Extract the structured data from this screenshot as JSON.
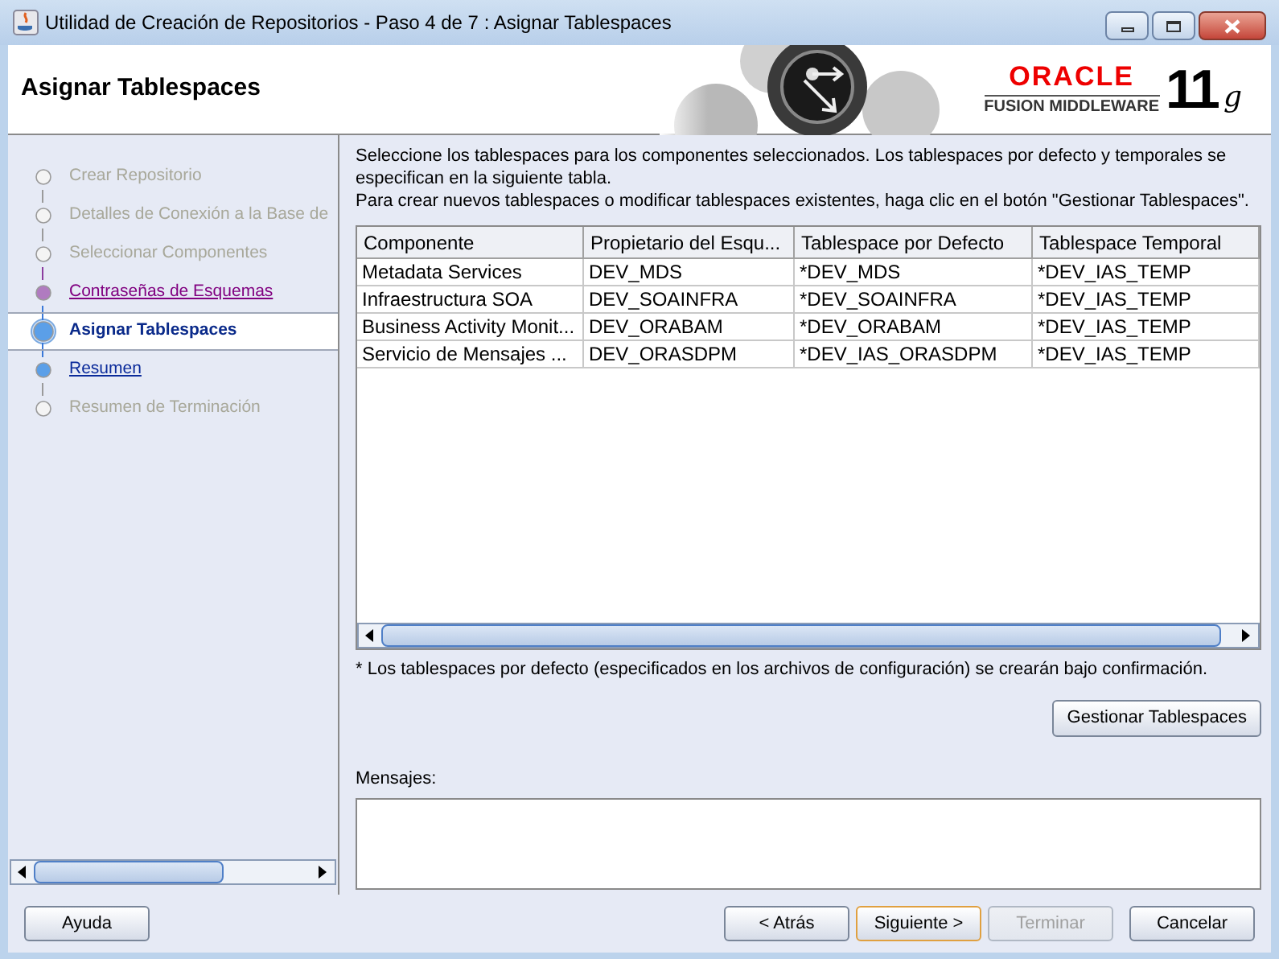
{
  "window": {
    "title": "Utilidad de Creación de Repositorios - Paso 4 de 7 : Asignar Tablespaces"
  },
  "header": {
    "title": "Asignar Tablespaces",
    "brand": "ORACLE",
    "product": "FUSION MIDDLEWARE",
    "version": "11",
    "version_suffix": "g"
  },
  "steps": [
    {
      "label": "Crear Repositorio",
      "kind": "done"
    },
    {
      "label": "Detalles de Conexión a la Base de",
      "kind": "done"
    },
    {
      "label": "Seleccionar Componentes",
      "kind": "done"
    },
    {
      "label": "Contraseñas de Esquemas",
      "kind": "visited"
    },
    {
      "label": "Asignar Tablespaces",
      "kind": "current"
    },
    {
      "label": "Resumen",
      "kind": "link"
    },
    {
      "label": "Resumen de Terminación",
      "kind": "pending"
    }
  ],
  "intro": [
    "Seleccione los tablespaces para los componentes seleccionados. Los tablespaces por defecto y temporales se especifican en la siguiente tabla.",
    "Para crear nuevos tablespaces o modificar tablespaces existentes, haga clic en el botón \"Gestionar Tablespaces\"."
  ],
  "table": {
    "columns": [
      "Componente",
      "Propietario del Esqu...",
      "Tablespace por Defecto",
      "Tablespace Temporal"
    ],
    "rows": [
      [
        "Metadata Services",
        "DEV_MDS",
        "*DEV_MDS",
        "*DEV_IAS_TEMP"
      ],
      [
        "Infraestructura SOA",
        "DEV_SOAINFRA",
        "*DEV_SOAINFRA",
        "*DEV_IAS_TEMP"
      ],
      [
        "Business Activity Monit...",
        "DEV_ORABAM",
        "*DEV_ORABAM",
        "*DEV_IAS_TEMP"
      ],
      [
        "Servicio de Mensajes ...",
        "DEV_ORASDPM",
        "*DEV_IAS_ORASDPM",
        "*DEV_IAS_TEMP"
      ]
    ]
  },
  "footnote": "* Los tablespaces por defecto (especificados en los archivos de configuración) se crearán bajo confirmación.",
  "manage_button": "Gestionar Tablespaces",
  "messages": {
    "label": "Mensajes:"
  },
  "buttons": [
    {
      "label": "Ayuda",
      "disabled": false,
      "default": false
    },
    {
      "label": "< Atrás",
      "disabled": false,
      "default": false
    },
    {
      "label": "Siguiente >",
      "disabled": false,
      "default": true
    },
    {
      "label": "Terminar",
      "disabled": true,
      "default": false
    },
    {
      "label": "Cancelar",
      "disabled": false,
      "default": false
    }
  ]
}
